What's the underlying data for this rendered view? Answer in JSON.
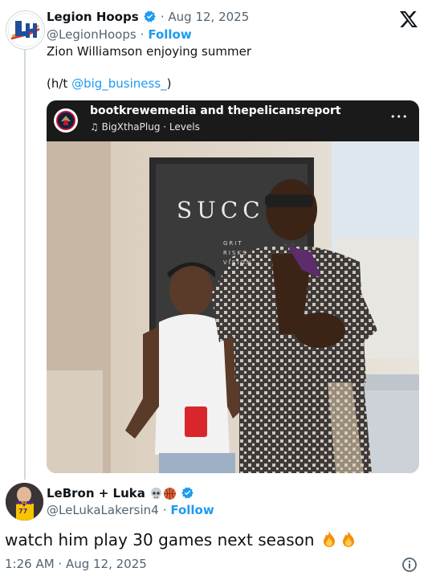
{
  "tweet": {
    "author_name": "Legion Hoops",
    "date": "Aug 12, 2025",
    "handle": "@LegionHoops",
    "follow_label": "Follow",
    "text_line1": "Zion Williamson enjoying summer",
    "hat_tip_prefix": "(h/t ",
    "hat_tip_handle": "@big_business_",
    "hat_tip_suffix": ")",
    "avatar_logo_text": "LH"
  },
  "embed": {
    "accounts": "bootkrewemedia and thepelicansreport",
    "audio": "BigXthaPlug · Levels",
    "more_label": "•••",
    "poster_text": "SUCC",
    "small_lines": [
      "GRIT",
      "RISKS",
      "VISION"
    ]
  },
  "reply": {
    "author_name": "LeBron + Luka",
    "handle": "@LeLukaLakersin4",
    "follow_label": "Follow",
    "text": "watch him play 30 games next season",
    "timestamp": "1:26 AM · Aug 12, 2025",
    "jersey_number": "77",
    "jersey_text": "LAKERS"
  },
  "colors": {
    "verified": "#1d9bf0",
    "link": "#1d9bf0",
    "accent_follow": "#1d9bf0"
  },
  "icons": [
    "x-logo-icon",
    "verified-badge-icon",
    "music-note-icon",
    "more-icon",
    "info-icon",
    "skull-emoji",
    "basketball-emoji",
    "fire-emoji"
  ]
}
